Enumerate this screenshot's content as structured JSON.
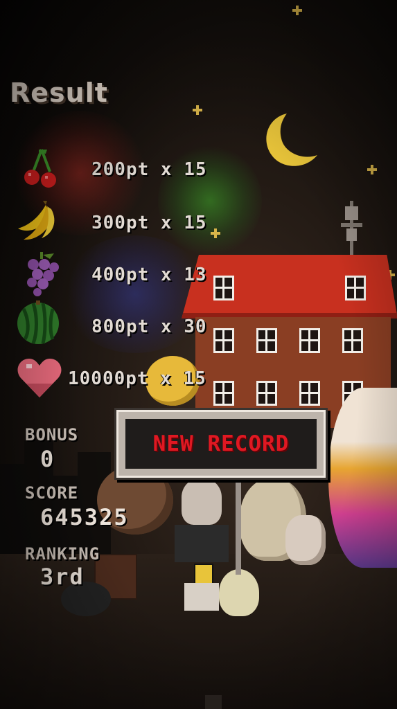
{
  "result": {
    "title": "Result",
    "items": [
      {
        "icon": "cherry-icon",
        "text": "200pt x 15"
      },
      {
        "icon": "banana-icon",
        "text": "300pt x 15"
      },
      {
        "icon": "grape-icon",
        "text": "400pt x 13"
      },
      {
        "icon": "watermelon-icon",
        "text": "800pt x 30"
      },
      {
        "icon": "heart-icon",
        "text": "10000pt x 15"
      }
    ],
    "bonus_label": "BONUS",
    "bonus_value": "0",
    "score_label": "SCORE",
    "score_value": "645325",
    "ranking_label": "RANKING",
    "ranking_value": "3rd",
    "new_record_label": "NEW RECORD"
  },
  "colors": {
    "sign_text": "#e01822",
    "roof": "#c8301f",
    "building": "#8a3e23",
    "moon": "#e8c43a"
  }
}
